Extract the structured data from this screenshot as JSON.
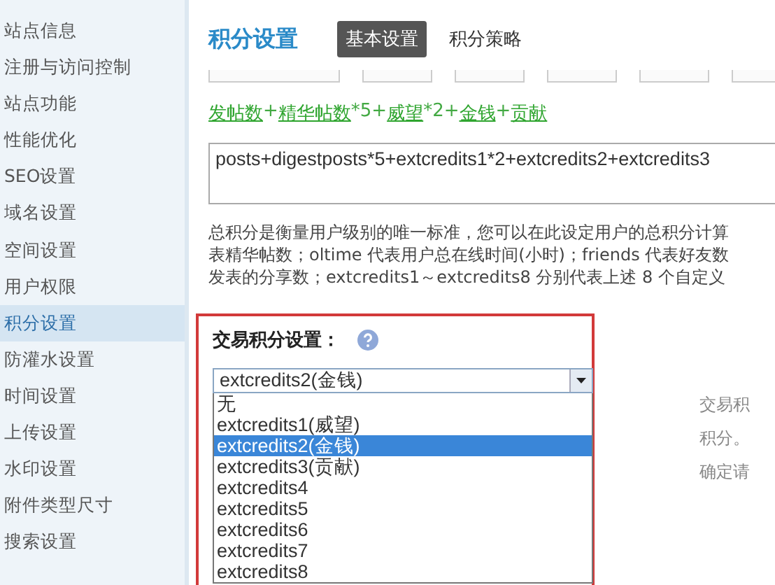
{
  "sidebar": {
    "items": [
      {
        "label": "站点信息",
        "selected": false
      },
      {
        "label": "注册与访问控制",
        "selected": false
      },
      {
        "label": "站点功能",
        "selected": false
      },
      {
        "label": "性能优化",
        "selected": false
      },
      {
        "label": "SEO设置",
        "selected": false
      },
      {
        "label": "域名设置",
        "selected": false
      },
      {
        "label": "空间设置",
        "selected": false
      },
      {
        "label": "用户权限",
        "selected": false
      },
      {
        "label": "积分设置",
        "selected": true
      },
      {
        "label": "防灌水设置",
        "selected": false
      },
      {
        "label": "时间设置",
        "selected": false
      },
      {
        "label": "上传设置",
        "selected": false
      },
      {
        "label": "水印设置",
        "selected": false
      },
      {
        "label": "附件类型尺寸",
        "selected": false
      },
      {
        "label": "搜索设置",
        "selected": false
      }
    ]
  },
  "page": {
    "title": "积分设置",
    "tabs": [
      {
        "label": "基本设置",
        "selected": true
      },
      {
        "label": "积分策略",
        "selected": false
      }
    ]
  },
  "formula_parts": [
    {
      "text": "发帖数",
      "kind": "link"
    },
    {
      "text": "+",
      "kind": "plain"
    },
    {
      "text": "精华帖数",
      "kind": "link"
    },
    {
      "text": "*5+",
      "kind": "plain"
    },
    {
      "text": "威望",
      "kind": "link"
    },
    {
      "text": "*2+",
      "kind": "plain"
    },
    {
      "text": "金钱",
      "kind": "link"
    },
    {
      "text": "+",
      "kind": "plain"
    },
    {
      "text": "贡献",
      "kind": "link"
    }
  ],
  "formula_value": "posts+digestposts*5+extcredits1*2+extcredits2+extcredits3",
  "description_lines": [
    "总积分是衡量用户级别的唯一标准，您可以在此设定用户的总积分计算",
    "表精华帖数；oltime 代表用户总在线时间(小时)；friends 代表好友数",
    "发表的分享数；extcredits1～extcredits8 分别代表上述 8 个自定义"
  ],
  "trade_credit": {
    "label": "交易积分设置：",
    "select": {
      "value": "extcredits2(金钱)",
      "expanded": true,
      "options": [
        {
          "label": "无",
          "selected": false
        },
        {
          "label": "extcredits1(威望)",
          "selected": false
        },
        {
          "label": "extcredits2(金钱)",
          "selected": true
        },
        {
          "label": "extcredits3(贡献)",
          "selected": false
        },
        {
          "label": "extcredits4",
          "selected": false
        },
        {
          "label": "extcredits5",
          "selected": false
        },
        {
          "label": "extcredits6",
          "selected": false
        },
        {
          "label": "extcredits7",
          "selected": false
        },
        {
          "label": "extcredits8",
          "selected": false
        }
      ]
    },
    "hint_lines": [
      "交易积",
      "积分。",
      "确定请"
    ]
  }
}
